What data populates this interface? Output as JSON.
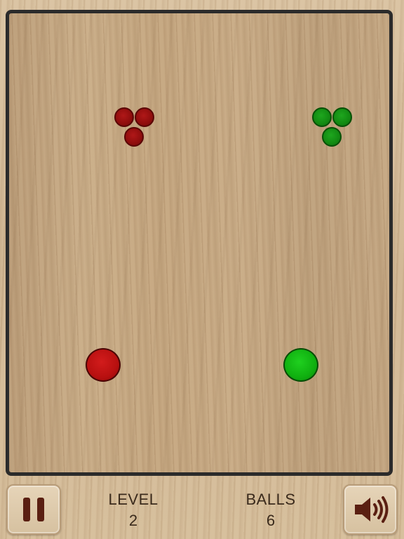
{
  "hud": {
    "level_label": "LEVEL",
    "level_value": "2",
    "balls_label": "BALLS",
    "balls_value": "6",
    "pause_icon": "pause-icon",
    "sound_icon": "speaker-volume-icon"
  },
  "colors": {
    "red_ball": "#b81010",
    "green_ball": "#10b010",
    "frame": "#2b2b2b",
    "hud_text": "#3a2a1c"
  },
  "game": {
    "red_targets": 3,
    "green_targets": 3,
    "players": [
      "red",
      "green"
    ]
  }
}
